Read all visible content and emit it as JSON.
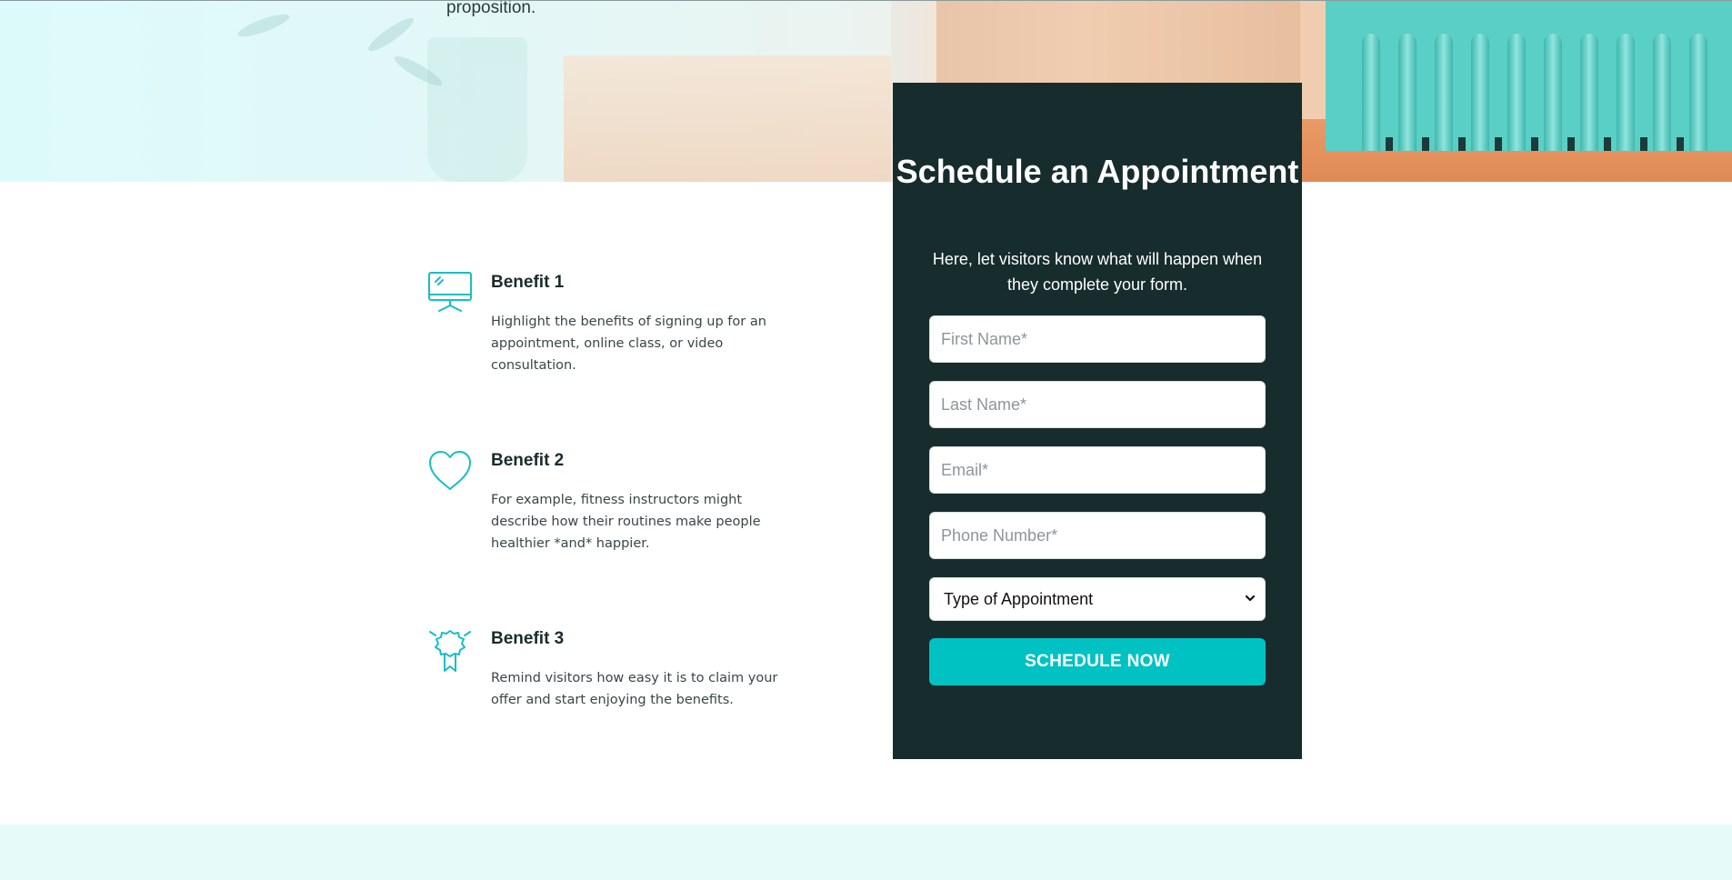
{
  "hero": {
    "text": "proposition."
  },
  "benefits": [
    {
      "icon": "monitor-icon",
      "title": "Benefit 1",
      "description": "Highlight the benefits of signing up for an appointment, online class, or video consultation."
    },
    {
      "icon": "heart-icon",
      "title": "Benefit 2",
      "description": "For example, fitness instructors might describe how their routines make people healthier *and* happier."
    },
    {
      "icon": "award-ribbon-icon",
      "title": "Benefit 3",
      "description": "Remind visitors how easy it is to claim your offer and start enjoying the benefits."
    }
  ],
  "form": {
    "title": "Schedule an Appointment",
    "subtitle": "Here, let visitors know what will happen when they complete your form.",
    "fields": {
      "first_name": {
        "placeholder": "First Name*",
        "value": ""
      },
      "last_name": {
        "placeholder": "Last Name*",
        "value": ""
      },
      "email": {
        "placeholder": "Email*",
        "value": ""
      },
      "phone": {
        "placeholder": "Phone Number*",
        "value": ""
      }
    },
    "appointment_type": {
      "selected": "Type of Appointment",
      "icon": "chevron-down-icon"
    },
    "submit_label": "SCHEDULE NOW"
  },
  "colors": {
    "accent": "#00c2c2",
    "card_background": "#172c2d",
    "icon_color": "#16bfc4",
    "bottom_band": "#e6fafa"
  }
}
